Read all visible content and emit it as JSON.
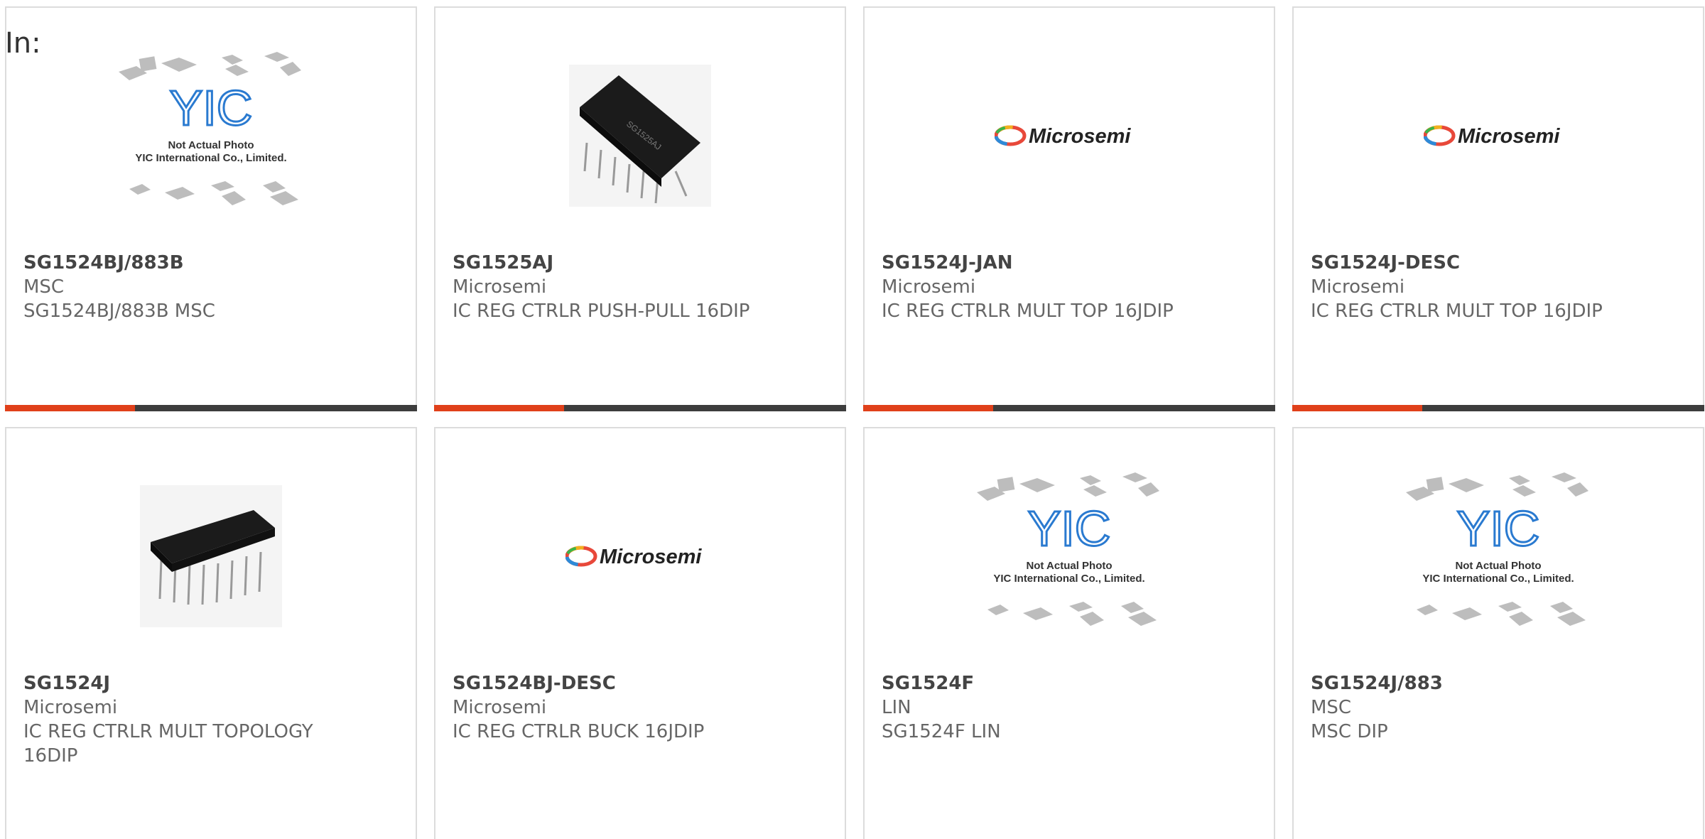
{
  "filter": {
    "label": "In:"
  },
  "placeholder": {
    "line1": "Not Actual Photo",
    "line2": "YIC International Co., Limited.",
    "logo_text": "YIC"
  },
  "microsemi_logo_text": "Microsemi",
  "chip_marking": "SG1525AJ",
  "colors": {
    "accent": "#e0401a",
    "bar": "#3d3d3d",
    "yic_blue": "#2a7ad0"
  },
  "products": [
    {
      "part": "SG1524BJ/883B",
      "mfr": "MSC",
      "desc": "SG1524BJ/883B MSC",
      "image": "yic-placeholder"
    },
    {
      "part": "SG1525AJ",
      "mfr": "Microsemi",
      "desc": "IC REG CTRLR PUSH-PULL 16DIP",
      "image": "dip-chip-photo"
    },
    {
      "part": "SG1524J-JAN",
      "mfr": "Microsemi",
      "desc": "IC REG CTRLR MULT TOP 16JDIP",
      "image": "microsemi-logo"
    },
    {
      "part": "SG1524J-DESC",
      "mfr": "Microsemi",
      "desc": "IC REG CTRLR MULT TOP 16JDIP",
      "image": "microsemi-logo"
    },
    {
      "part": "SG1524J",
      "mfr": "Microsemi",
      "desc": "IC REG CTRLR MULT TOPOLOGY 16DIP",
      "image": "dip-chip-photo"
    },
    {
      "part": "SG1524BJ-DESC",
      "mfr": "Microsemi",
      "desc": "IC REG CTRLR BUCK 16JDIP",
      "image": "microsemi-logo"
    },
    {
      "part": "SG1524F",
      "mfr": "LIN",
      "desc": "SG1524F LIN",
      "image": "yic-placeholder"
    },
    {
      "part": "SG1524J/883",
      "mfr": "MSC",
      "desc": "MSC DIP",
      "image": "yic-placeholder"
    }
  ]
}
